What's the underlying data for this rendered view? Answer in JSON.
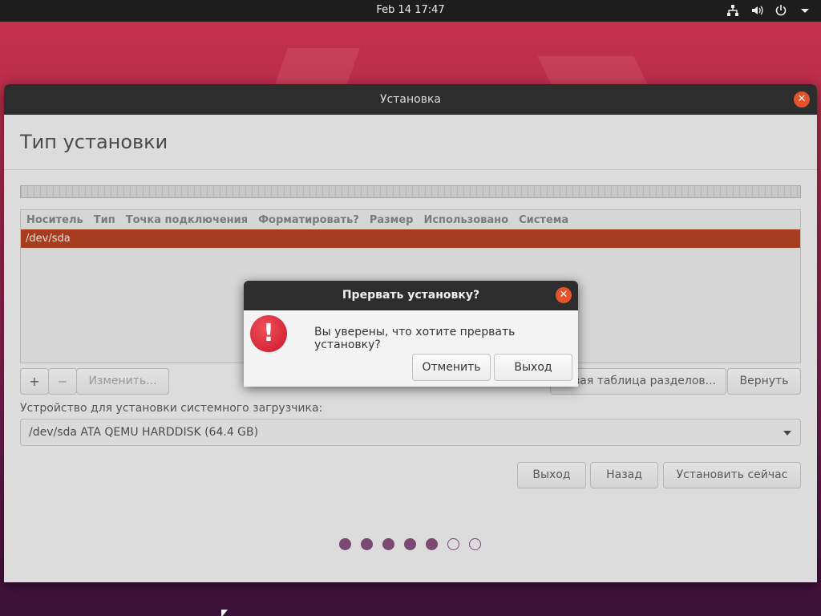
{
  "topbar": {
    "clock": "Feb 14  17:47"
  },
  "window": {
    "title": "Установка",
    "heading": "Тип установки",
    "table": {
      "columns": [
        "Носитель",
        "Тип",
        "Точка подключения",
        "Форматировать?",
        "Размер",
        "Использовано",
        "Система"
      ],
      "rows": [
        {
          "device": "/dev/sda"
        }
      ]
    },
    "toolbar": {
      "add": "+",
      "remove": "−",
      "change": "Изменить...",
      "new_table": "Новая таблица разделов...",
      "revert": "Вернуть"
    },
    "boot": {
      "label": "Устройство для установки системного загрузчика:",
      "value": "/dev/sda ATA QEMU HARDDISK (64.4 GB)"
    },
    "buttons": {
      "quit": "Выход",
      "back": "Назад",
      "install": "Установить сейчас"
    },
    "progress": {
      "completed_steps": 5,
      "total_steps": 7
    }
  },
  "dialog": {
    "title": "Прервать установку?",
    "icon": "!",
    "message": "Вы уверены, что хотите прервать установку?",
    "cancel": "Отменить",
    "quit": "Выход"
  },
  "colors": {
    "accent": "#a63d1f",
    "close": "#e5532c",
    "progress": "#7a4a72"
  }
}
